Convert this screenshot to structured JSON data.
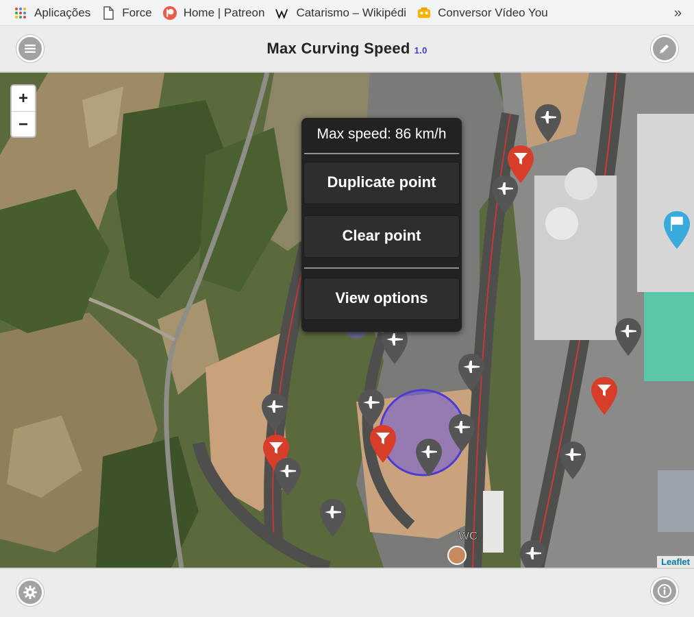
{
  "bookmarks": [
    {
      "label": "Aplicações",
      "icon": "apps-grid-icon"
    },
    {
      "label": "Force",
      "icon": "page-icon"
    },
    {
      "label": "Home | Patreon",
      "icon": "patreon-icon"
    },
    {
      "label": "Catarismo – Wikipédi",
      "icon": "wikipedia-icon"
    },
    {
      "label": "Conversor Vídeo You",
      "icon": "converter-icon"
    }
  ],
  "bookmarks_more": "»",
  "header": {
    "title": "Max Curving Speed",
    "version": "1.0",
    "menu_icon": "menu-icon",
    "edit_icon": "pencil-icon"
  },
  "map": {
    "zoom_in": "+",
    "zoom_out": "−",
    "attribution": "Leaflet",
    "wc_label": "WC"
  },
  "popup": {
    "speed_text": "Max speed: 86 km/h",
    "duplicate_label": "Duplicate point",
    "clear_label": "Clear point",
    "view_options_label": "View options"
  },
  "footer": {
    "settings_icon": "gear-icon",
    "info_icon": "info-icon"
  },
  "colors": {
    "marker_gray": "#555555",
    "marker_red": "#d63e2a",
    "marker_blue": "#38aadd",
    "version_blue": "#3b3bd6",
    "popup_bg": "#222222"
  }
}
